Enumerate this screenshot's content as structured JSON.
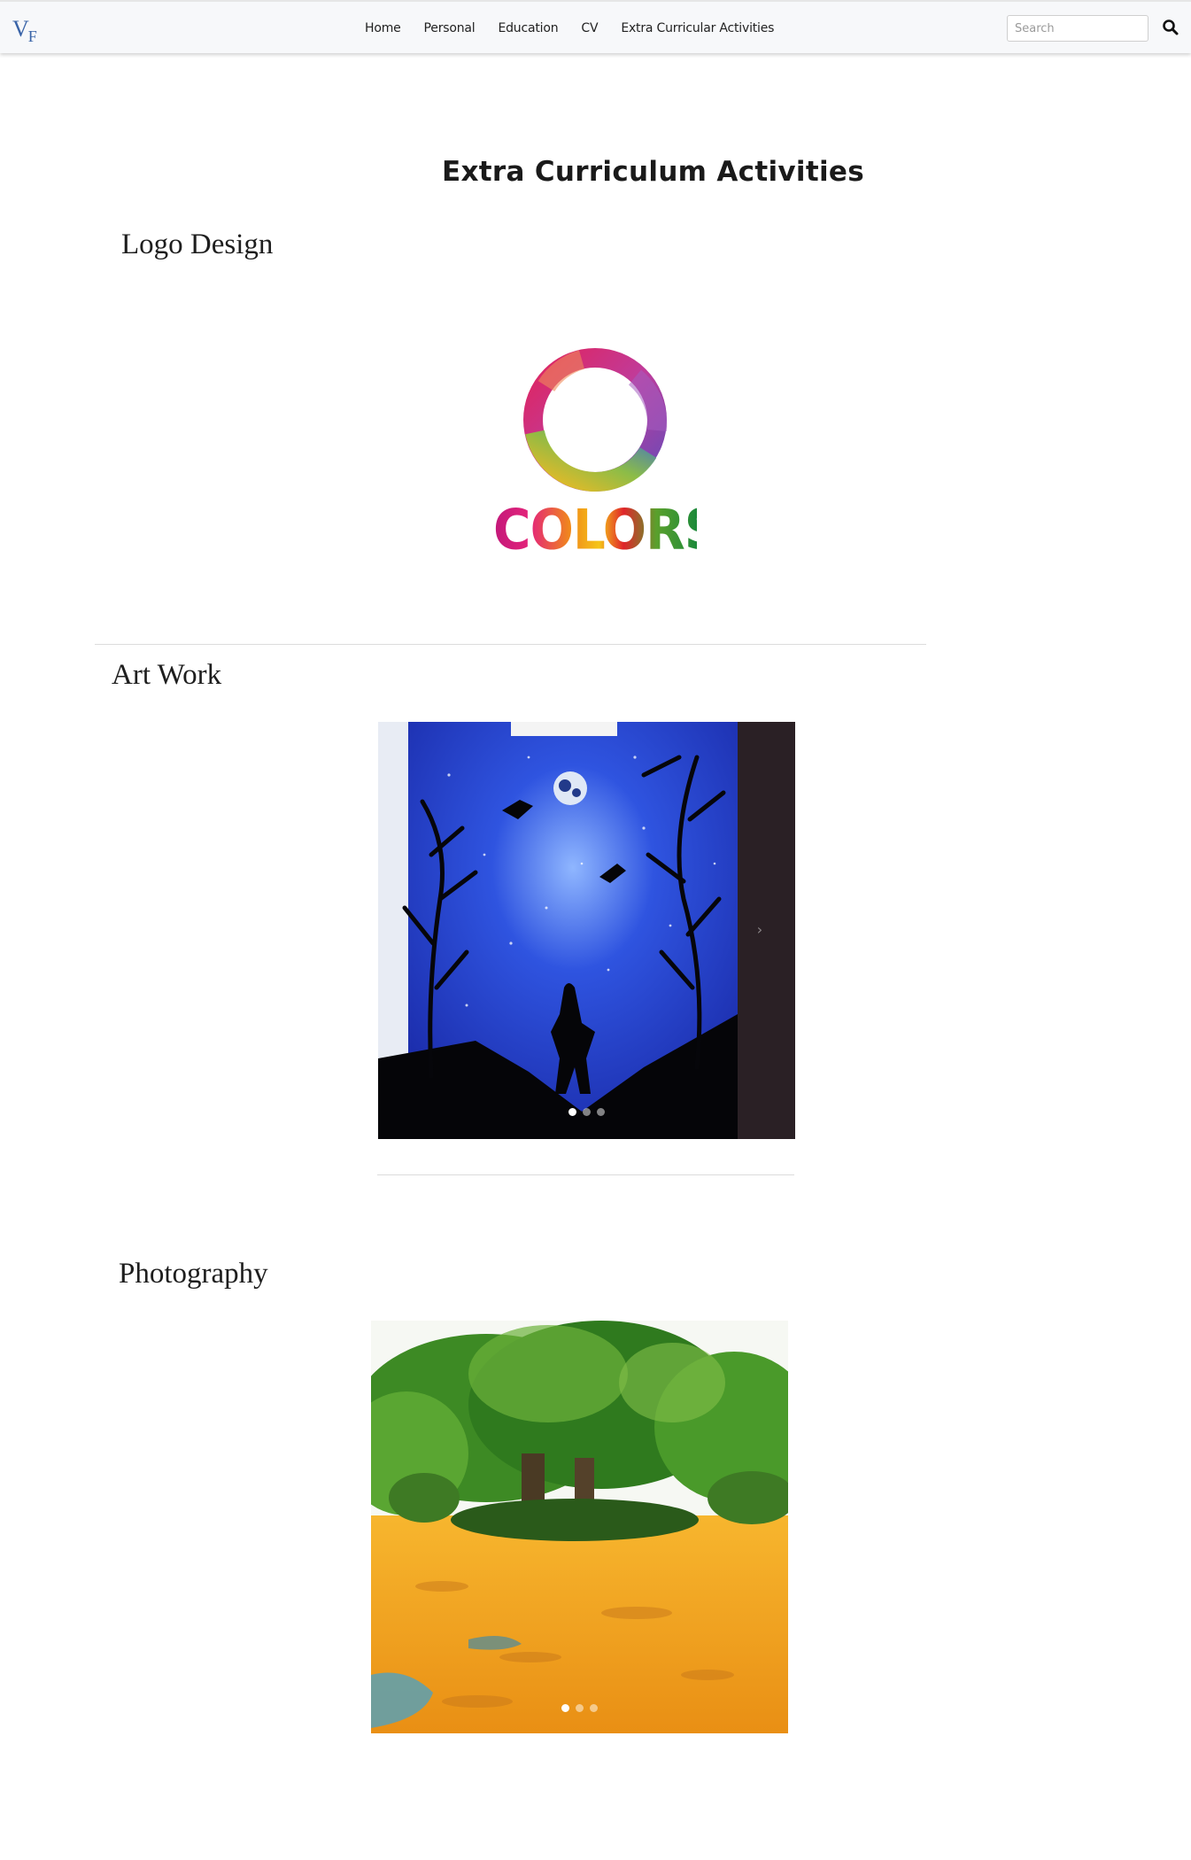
{
  "nav": {
    "brand": {
      "main": "V",
      "sub": "F"
    },
    "links": [
      {
        "label": "Home"
      },
      {
        "label": "Personal"
      },
      {
        "label": "Education"
      },
      {
        "label": "CV"
      },
      {
        "label": "Extra Curricular Activities"
      }
    ],
    "search": {
      "placeholder": "Search",
      "value": ""
    },
    "icons": {
      "search_button": "search-icon"
    }
  },
  "main": {
    "heading": "Extra Curriculum Activities",
    "sections": {
      "logo_design": {
        "title": "Logo Design",
        "logo_text": "COLORS"
      },
      "art_work": {
        "title": "Art Work",
        "slide_count": 3,
        "active_slide": 1
      },
      "photography": {
        "title": "Photography",
        "slide_count": 3,
        "active_slide": 1
      }
    }
  },
  "colors": {
    "brand": "#3a64a8",
    "navbar_bg": "#f7f8fa",
    "art_sky": "#1f3ec8",
    "photo_foliage": "#2f7a1e",
    "photo_leaves": "#f0a81e"
  }
}
